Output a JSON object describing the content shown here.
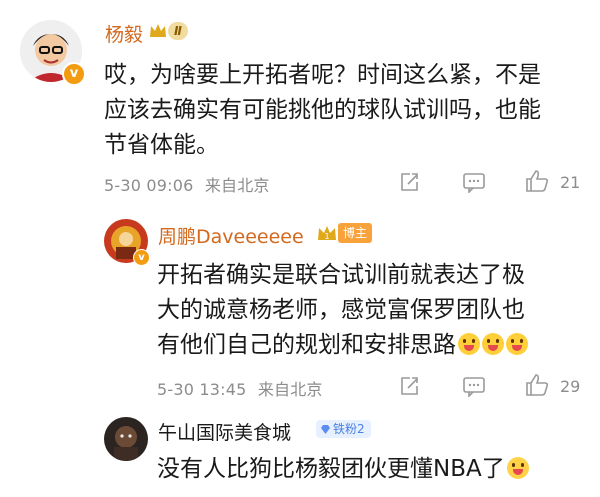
{
  "comment1": {
    "username": "杨毅",
    "level_badge": "Ⅱ",
    "text": "哎，为啥要上开拓者呢？时间这么紧，不是应该去确实有可能挑他的球队试训吗，也能节省体能。",
    "line1": "哎，为啥要上开拓者呢？时间这么紧，不是",
    "line2": "应该去确实有可能挑他的球队试训吗，也能",
    "line3": "节省体能。",
    "time": "5-30 09:06",
    "location": "来自北京",
    "likes": "21"
  },
  "reply1": {
    "username": "周鹏Daveeeeee",
    "role_badge": "博主",
    "line1": "开拓者确实是联合试训前就表达了极",
    "line2": "大的诚意杨老师，感觉富保罗团队也",
    "line3": "有他们自己的规划和安排思路",
    "time": "5-30 13:45",
    "location": "来自北京",
    "likes": "29"
  },
  "reply2": {
    "username": "午山国际美食城",
    "fan_badge": "铁粉2",
    "line1": "没有人比狗比杨毅团伙更懂NBA了"
  },
  "colors": {
    "name_orange": "#d2691e",
    "meta_gray": "#8c8c8c"
  },
  "icons": [
    "crown-icon",
    "verified-icon",
    "share-icon",
    "comment-icon",
    "like-icon",
    "diamond-icon"
  ]
}
